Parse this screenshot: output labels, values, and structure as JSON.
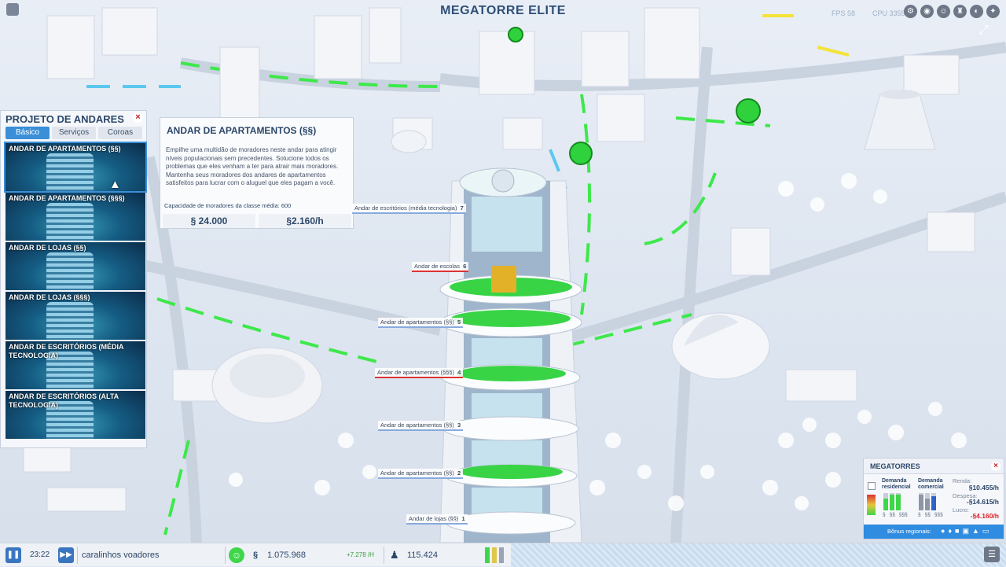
{
  "title": "MEGATORRE ELITE",
  "top_stats": {
    "fps": "FPS 58",
    "cpu": "CPU 3355"
  },
  "top_icons": [
    "settings-icon",
    "globe-icon",
    "people-icon",
    "camera-icon",
    "trophy-icon",
    "gear-icon"
  ],
  "panel": {
    "title": "PROJETO DE ANDARES",
    "tabs": [
      "Básico",
      "Serviços",
      "Coroas"
    ],
    "active_tab": "Básico",
    "items": [
      {
        "label": "ANDAR DE APARTAMENTOS (§§)",
        "icon": "bed-icon"
      },
      {
        "label": "ANDAR DE APARTAMENTOS (§§§)",
        "icon": "bed-icon"
      },
      {
        "label": "ANDAR DE LOJAS (§§)",
        "icon": "bag-icon"
      },
      {
        "label": "ANDAR DE LOJAS (§§§)",
        "icon": "bag-icon"
      },
      {
        "label": "ANDAR DE ESCRITÓRIOS (MÉDIA TECNOLOGIA)",
        "icon": "office-icon"
      },
      {
        "label": "ANDAR DE ESCRITÓRIOS (ALTA TECNOLOGIA)",
        "icon": "office-icon"
      }
    ]
  },
  "tooltip": {
    "title": "ANDAR DE APARTAMENTOS (§§)",
    "description": "Empilhe uma multidão de moradores neste andar para atingir níveis populacionais sem precedentes. Solucione todos os problemas que eles venham a ter para atrair mais moradores. Mantenha seus moradores dos andares de apartamentos satisfeitos para lucrar com o aluguel que eles pagam a você.",
    "capacity": "Capacidade de moradores da classe média: 600",
    "cost": "§ 24.000",
    "upkeep": "§2.160/h"
  },
  "floors": [
    {
      "label": "Andar de escritórios (média tecnologia)",
      "n": "7"
    },
    {
      "label": "Andar de escolas",
      "n": "6"
    },
    {
      "label": "Andar de apartamentos (§§)",
      "n": "5"
    },
    {
      "label": "Andar de apartamentos (§§§)",
      "n": "4"
    },
    {
      "label": "Andar de apartamentos (§§)",
      "n": "3"
    },
    {
      "label": "Andar de apartamentos (§§)",
      "n": "2"
    },
    {
      "label": "Andar de lojas (§§)",
      "n": "1"
    }
  ],
  "megatorres": {
    "title": "MEGATORRES",
    "col_residential": "Demanda residencial",
    "col_commercial": "Demanda comercial",
    "tiers": [
      "§",
      "§§",
      "§§§",
      "§",
      "§§",
      "§§§"
    ],
    "renda_label": "Renda:",
    "renda_value": "§10.455/h",
    "despesa_label": "Despesa:",
    "despesa_value": "-§14.615/h",
    "lucro_label": "Lucro:",
    "lucro_value": "-§4.160/h",
    "bonus_label": "Bônus regionais:",
    "demand_res": [
      0.7,
      0.9,
      0.9
    ],
    "demand_com": [
      0.9,
      0.7,
      0.8
    ],
    "colors": {
      "res": "#3fd64a",
      "com": "#8d96a6",
      "com_high": "#2b63c9"
    }
  },
  "bottom": {
    "time": "23:22",
    "city_name": "caralinhos voadores",
    "money": "1.075.968",
    "income": "+7.278 /H",
    "population": "115.424"
  }
}
